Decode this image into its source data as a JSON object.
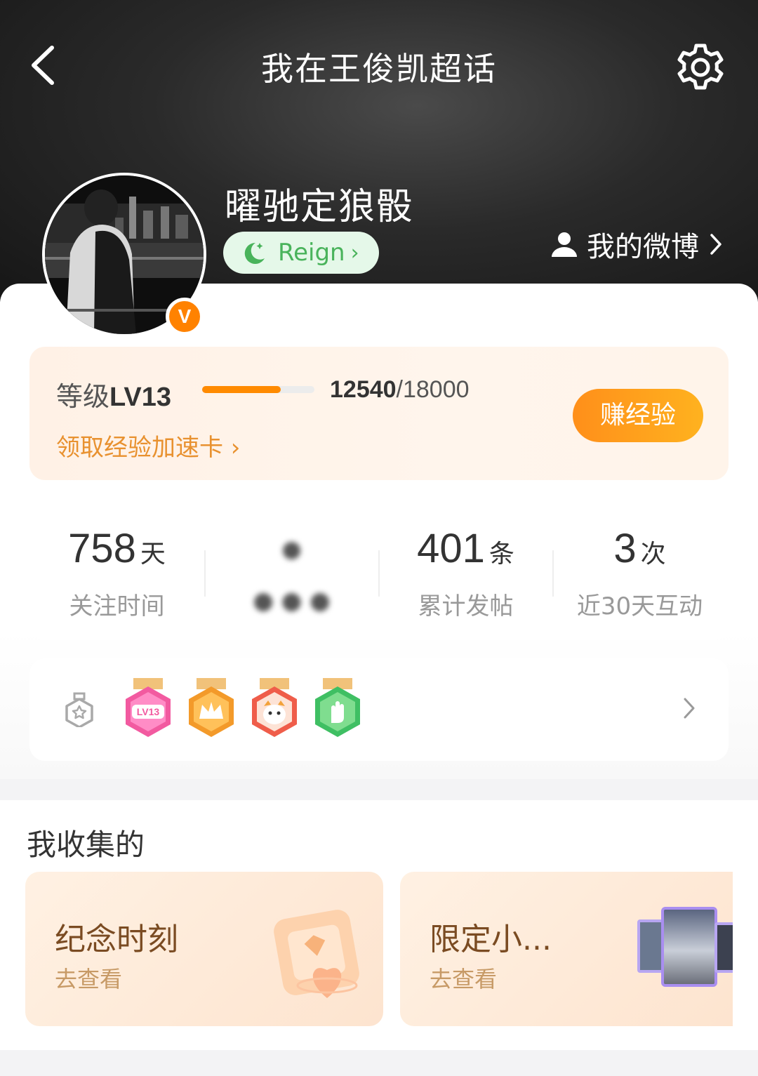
{
  "nav": {
    "title": "我在王俊凯超话",
    "back_icon": "chevron-left-icon",
    "settings_icon": "gear-icon"
  },
  "profile": {
    "username": "曜驰定狼骰",
    "verified_badge": "V",
    "title_pill": {
      "label": "Reign",
      "icon": "moon-star-icon",
      "color": "#49b35b"
    },
    "my_weibo": "我的微博"
  },
  "level": {
    "label_prefix": "等级",
    "level": "LV13",
    "current_exp": "12540",
    "max_exp": "/18000",
    "progress": 0.7,
    "boost_link": "领取经验加速卡 ›",
    "earn_button": "赚经验",
    "accent": "#ff8a00"
  },
  "stats": [
    {
      "value": "758",
      "unit": "天",
      "label": "关注时间"
    },
    {
      "value": "●",
      "unit": "",
      "label": "● ● ●"
    },
    {
      "value": "401",
      "unit": "条",
      "label": "累计发帖"
    },
    {
      "value": "3",
      "unit": "次",
      "label": "近30天互动"
    }
  ],
  "badges": {
    "items": [
      "LV13",
      "crown",
      "cartoon",
      "hand"
    ],
    "level_medal_text": "LV13"
  },
  "collection": {
    "title": "我收集的",
    "cards": [
      {
        "title": "纪念时刻",
        "subtitle": "去查看"
      },
      {
        "title": "限定小...",
        "subtitle": "去查看"
      }
    ]
  }
}
